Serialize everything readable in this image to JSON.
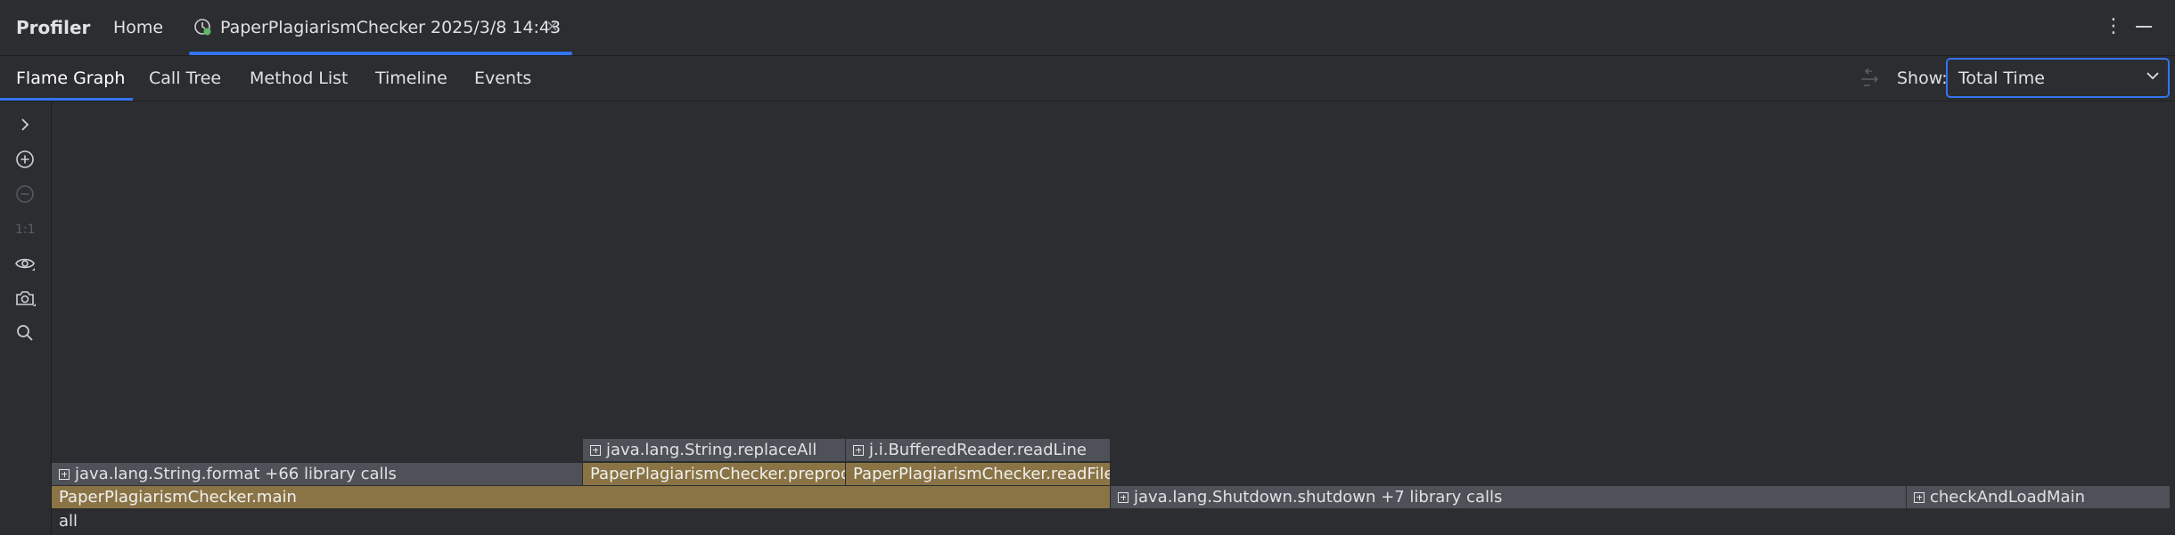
{
  "header": {
    "app_title": "Profiler",
    "home_tab": "Home",
    "session_tab": "PaperPlagiarismChecker 2025/3/8 14:43",
    "close_glyph": "×",
    "more_glyph": "⋮"
  },
  "views": {
    "tabs": [
      "Flame Graph",
      "Call Tree",
      "Method List",
      "Timeline",
      "Events"
    ],
    "active": "Flame Graph"
  },
  "show": {
    "label": "Show:",
    "value": "Total Time"
  },
  "sidebar": {
    "actual_size_label": "1:1",
    "icons": [
      "chevron-right-icon",
      "zoom-in-icon",
      "zoom-out-icon",
      "eye-icon",
      "camera-icon",
      "search-icon"
    ]
  },
  "flame": {
    "level4": {
      "replace_all": "java.lang.String.replaceAll",
      "read_line": "j.i.BufferedReader.readLine"
    },
    "level3": {
      "string_format": "java.lang.String.format  +66 library calls",
      "preprocess": "PaperPlagiarismChecker.preprocess",
      "read_file": "PaperPlagiarismChecker.readFile"
    },
    "level2": {
      "main": "PaperPlagiarismChecker.main",
      "shutdown": "java.lang.Shutdown.shutdown  +7 library calls",
      "check_and_load": "checkAndLoadMain"
    },
    "level1": {
      "all": "all"
    }
  },
  "colors": {
    "accent": "#3574f0",
    "background": "#2b2d30",
    "frame_gray": "#4e5157",
    "frame_gold": "#8a7446"
  }
}
